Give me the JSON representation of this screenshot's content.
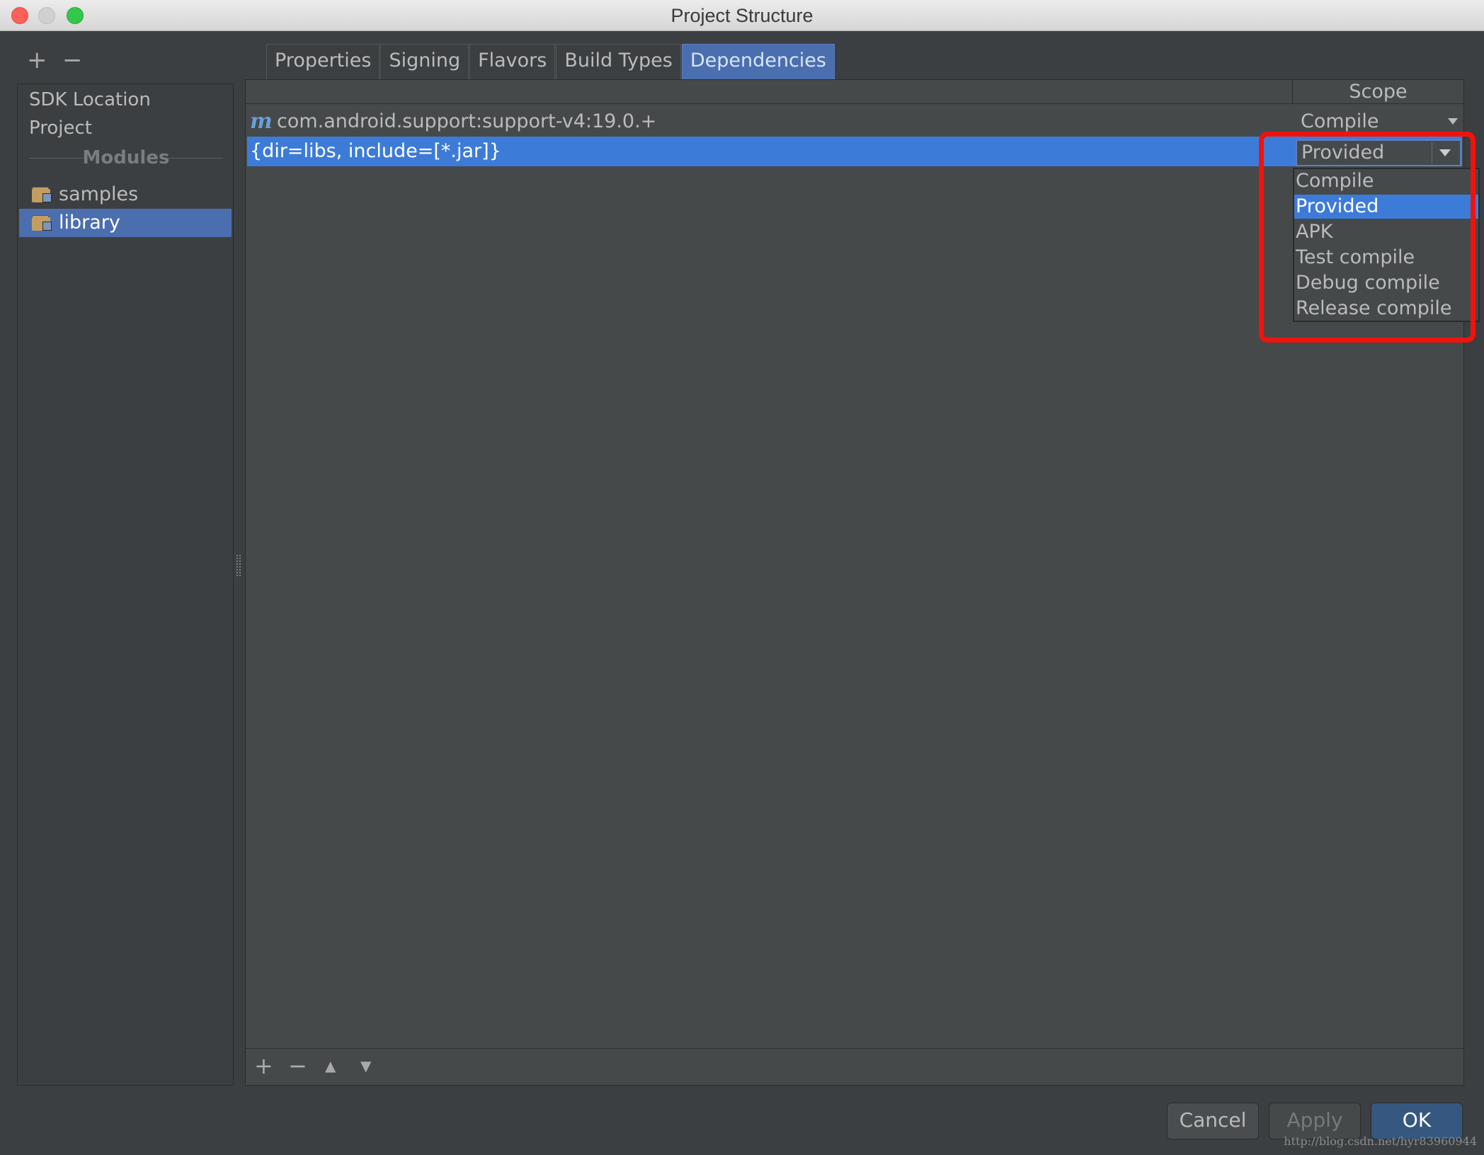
{
  "window": {
    "title": "Project Structure"
  },
  "left": {
    "tools": {
      "add": "+",
      "remove": "−"
    },
    "items": [
      {
        "label": "SDK Location"
      },
      {
        "label": "Project"
      }
    ],
    "modules_header": "Modules",
    "modules": [
      {
        "label": "samples",
        "selected": false
      },
      {
        "label": "library",
        "selected": true
      }
    ]
  },
  "tabs": [
    {
      "label": "Properties"
    },
    {
      "label": "Signing"
    },
    {
      "label": "Flavors"
    },
    {
      "label": "Build Types"
    },
    {
      "label": "Dependencies",
      "active": true
    }
  ],
  "table": {
    "header_scope": "Scope",
    "rows": [
      {
        "icon_letter": "m",
        "name": "com.android.support:support-v4:19.0.+",
        "scope": "Compile"
      },
      {
        "name": "{dir=libs, include=[*.jar]}",
        "scope": "Provided"
      }
    ]
  },
  "scope_dropdown": {
    "value": "Provided",
    "options": [
      "Compile",
      "Provided",
      "APK",
      "Test compile",
      "Debug compile",
      "Release compile"
    ],
    "selected": "Provided"
  },
  "bottom_toolbar": {
    "add": "+",
    "remove": "−",
    "up": "▲",
    "down": "▼"
  },
  "buttons": {
    "cancel": "Cancel",
    "apply": "Apply",
    "ok": "OK"
  },
  "watermark": "http://blog.csdn.net/hyr83960944",
  "colors": {
    "selection": "#3d7bd8",
    "highlight": "#f2120c",
    "background": "#3c3f41"
  }
}
